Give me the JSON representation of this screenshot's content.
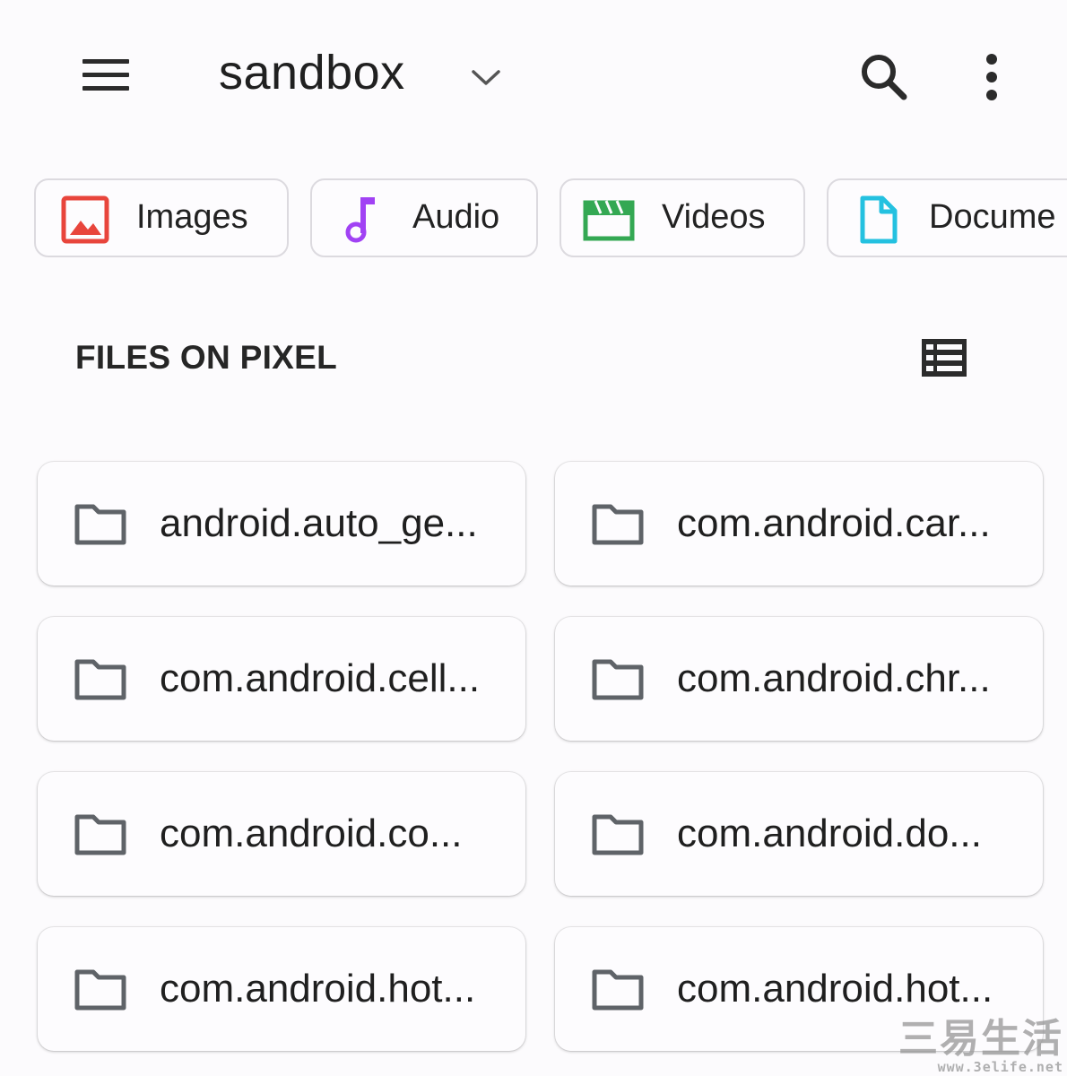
{
  "appbar": {
    "title": "sandbox",
    "icons": [
      "menu-icon",
      "chevron-down-icon",
      "search-icon",
      "more-vert-icon"
    ]
  },
  "chips": [
    {
      "label": "Images",
      "icon": "image-icon",
      "color": "#e8453c"
    },
    {
      "label": "Audio",
      "icon": "music-note-icon",
      "color": "#a142f4"
    },
    {
      "label": "Videos",
      "icon": "movie-icon",
      "color": "#34a853"
    },
    {
      "label": "Docume",
      "icon": "document-icon",
      "color": "#24c1e0"
    }
  ],
  "section": {
    "title": "FILES ON PIXEL",
    "view_icon": "list-view-icon"
  },
  "folders": [
    "android.auto_ge...",
    "com.android.car...",
    "com.android.cell...",
    "com.android.chr...",
    "com.android.co...",
    "com.android.do...",
    "com.android.hot...",
    "com.android.hot..."
  ],
  "watermark": {
    "text": "三易生活",
    "url": "www.3elife.net"
  },
  "colors": {
    "background": "#fcfbfd",
    "folder_icon": "#5f6368",
    "chip_border": "#dcdadf"
  }
}
